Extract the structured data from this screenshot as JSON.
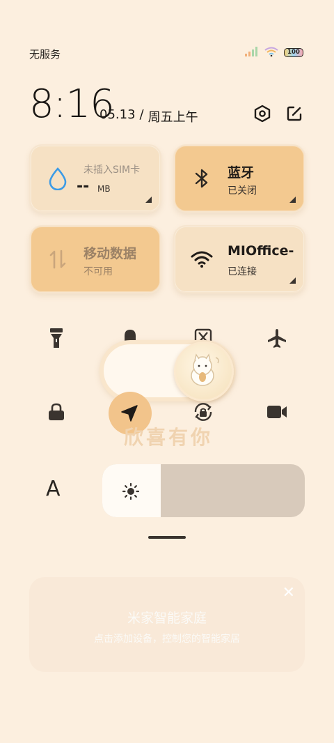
{
  "status_bar": {
    "carrier": "无服务",
    "battery": "100"
  },
  "clock": {
    "time": "8:16",
    "date": "05.13",
    "separator": "/",
    "weekday": "周五上午"
  },
  "tiles": {
    "data_usage": {
      "label": "未插入SIM卡",
      "value": "--",
      "unit": "MB",
      "icon": "droplet-icon"
    },
    "bluetooth": {
      "label": "蓝牙",
      "status": "已关闭",
      "icon": "bluetooth-icon"
    },
    "mobile_data": {
      "label": "移动数据",
      "status": "不可用",
      "icon": "data-arrows-icon"
    },
    "wifi": {
      "label": "MIOffice-",
      "status": "已连接",
      "icon": "wifi-icon"
    }
  },
  "toggles": {
    "row1": [
      "flashlight-icon",
      "bell-icon",
      "screenshot-icon",
      "airplane-icon"
    ],
    "row2": [
      "lock-icon",
      "location-icon",
      "auto-rotate-icon",
      "video-camera-icon"
    ],
    "watermark": "欣喜有你"
  },
  "brightness": {
    "auto_label": "A",
    "level_percent": 29
  },
  "smart_home": {
    "title": "米家智能家庭",
    "subtitle": "点击添加设备，控制您的智能家居",
    "close": "✕"
  },
  "colors": {
    "background": "#fcefdf",
    "tile_active": "#f3c990",
    "tile_inactive": "#f6e1c4",
    "accent_blue": "#3c9be6"
  }
}
